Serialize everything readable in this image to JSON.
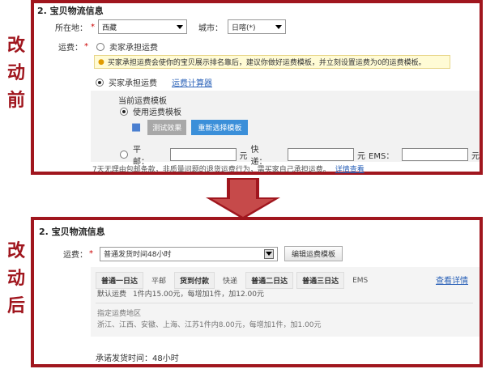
{
  "before": {
    "side_label": [
      "改",
      "动",
      "前"
    ],
    "title": "2. 宝贝物流信息",
    "location_label": "所在地：",
    "province": "西藏",
    "city_label": "城市：",
    "city": "日喀(*)",
    "freight_label": "运费：",
    "option_seller": "卖家承担运费",
    "notice": "买家承担运费会使你的宝贝展示排名靠后，建议你做好运费模板，并立刻设置运费为0的运费模板。",
    "option_buyer": "买家承担运费",
    "freight_calc_link": "运费计算器",
    "current_template": "当前运费模板",
    "use_template": "使用运费模板",
    "btn_test": "测试效果",
    "btn_reselect": "重新选择模板",
    "post_label": "平邮：",
    "unit1": "元",
    "express_label": "快递：",
    "unit2": "元",
    "ems_label": "EMS：",
    "unit3": "元",
    "footer_text": "7天无理由包邮条款，非质量问题的退货运费行为，需买家自己承担运费。",
    "details_link": "详情查看"
  },
  "after": {
    "side_label": [
      "改",
      "动",
      "后"
    ],
    "title": "2. 宝贝物流信息",
    "freight_label": "运费：",
    "template_select": "普通发货时间48小时",
    "btn_edit": "编辑运费模板",
    "tabs": [
      "普通一日达",
      "平邮",
      "货到付款",
      "快递",
      "普通二日达",
      "普通三日达",
      "EMS"
    ],
    "view_details": "查看详情",
    "default_freight": "默认运费",
    "default_rule": "1件内15.00元，每增加1件，加12.00元",
    "region_title": "指定运费地区",
    "region_rule": "浙江、江西、安徽、上海、江苏1件内8.00元，每增加1件，加1.00元",
    "ship_time": "承诺发货时间：48小时"
  }
}
